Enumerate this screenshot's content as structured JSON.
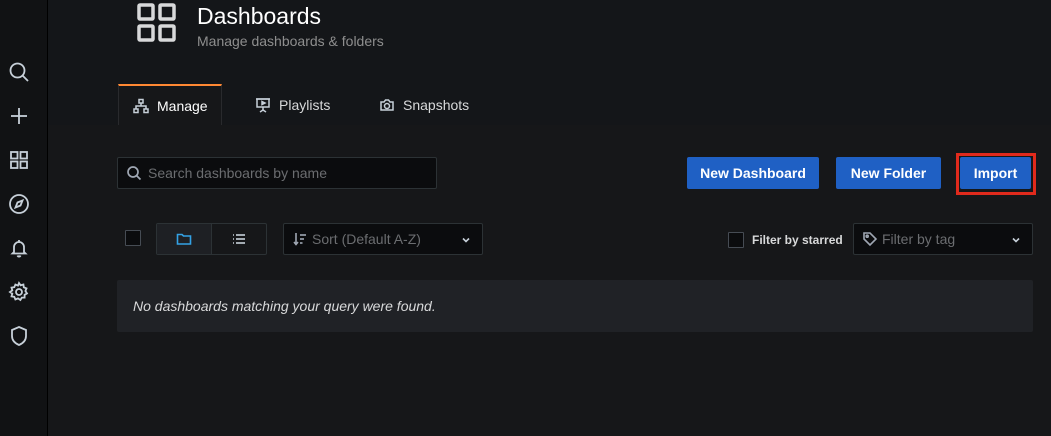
{
  "page_header": {
    "title": "Dashboards",
    "subtitle": "Manage dashboards & folders",
    "icon": "dashboards-grid-icon"
  },
  "sidebar": {
    "items": [
      {
        "icon": "search-icon"
      },
      {
        "icon": "plus-icon"
      },
      {
        "icon": "dashboards-icon"
      },
      {
        "icon": "compass-icon"
      },
      {
        "icon": "bell-icon"
      },
      {
        "icon": "gear-icon"
      },
      {
        "icon": "shield-icon"
      }
    ]
  },
  "tabs": [
    {
      "label": "Manage",
      "icon": "sitemap-icon",
      "active": true
    },
    {
      "label": "Playlists",
      "icon": "presentation-icon",
      "active": false
    },
    {
      "label": "Snapshots",
      "icon": "camera-icon",
      "active": false
    }
  ],
  "toolbar": {
    "search_placeholder": "Search dashboards by name",
    "new_dashboard_label": "New Dashboard",
    "new_folder_label": "New Folder",
    "import_label": "Import"
  },
  "filters": {
    "sort_placeholder": "Sort (Default A-Z)",
    "starred_label": "Filter by starred",
    "tag_placeholder": "Filter by tag",
    "view_mode": "folders"
  },
  "results": {
    "empty_message": "No dashboards matching your query were found."
  },
  "colors": {
    "primary": "#1f60c4",
    "tab_accent": "#ff8833",
    "highlight": "#e02a1c"
  }
}
